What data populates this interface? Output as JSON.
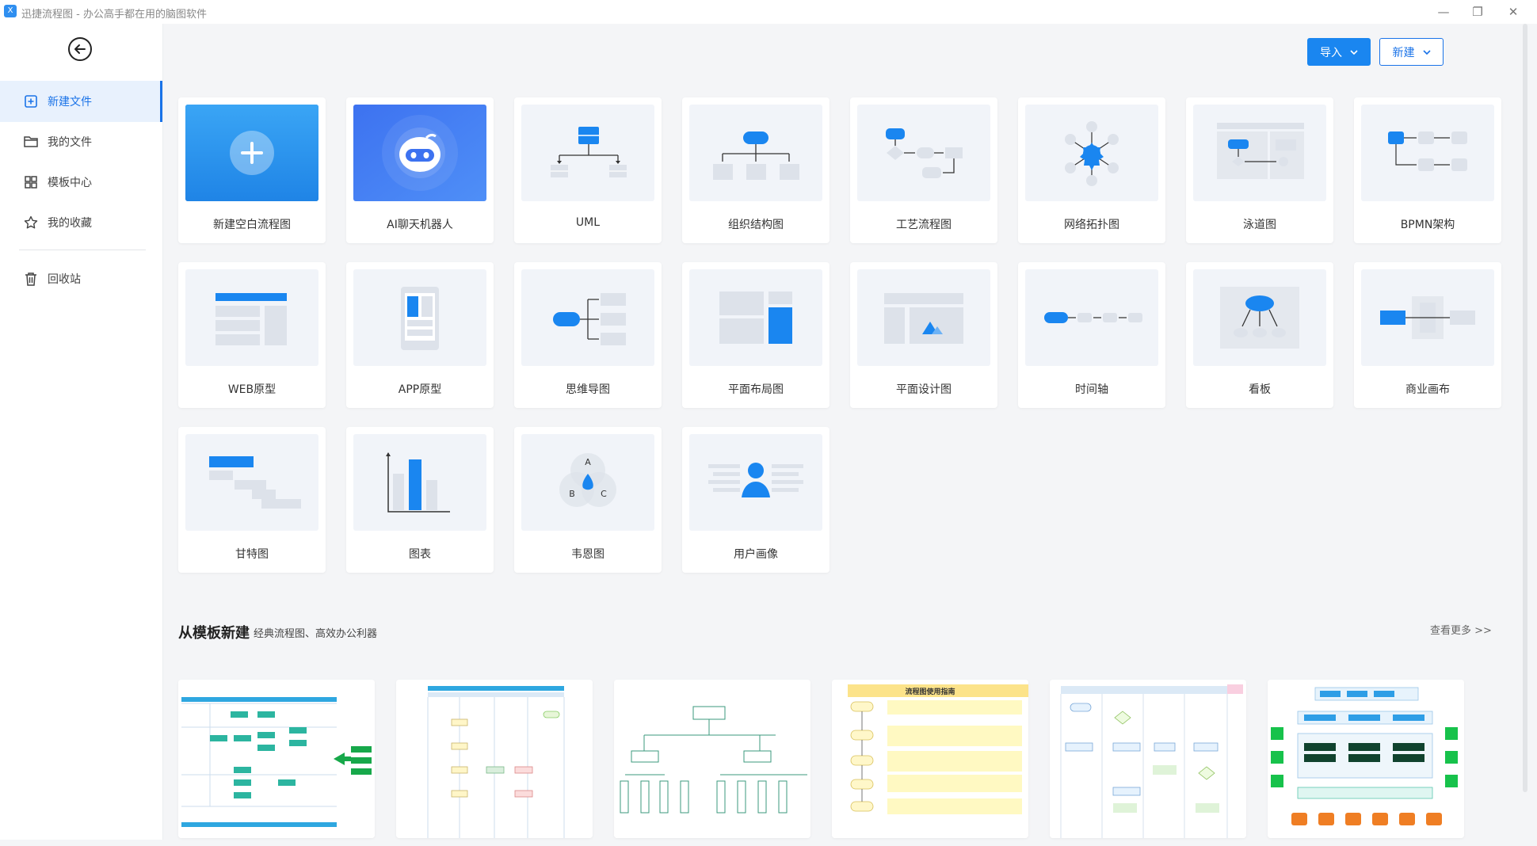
{
  "window": {
    "title": "迅捷流程图 - 办公高手都在用的脑图软件",
    "logo_text": "X",
    "controls": [
      "—",
      "❐",
      "✕"
    ]
  },
  "sidebar": {
    "items": [
      {
        "label": "新建文件",
        "icon": "add-file-icon",
        "active": true
      },
      {
        "label": "我的文件",
        "icon": "folder-icon",
        "active": false
      },
      {
        "label": "模板中心",
        "icon": "grid-icon",
        "active": false
      },
      {
        "label": "我的收藏",
        "icon": "star-icon",
        "active": false
      },
      {
        "label": "回收站",
        "icon": "trash-icon",
        "active": false
      }
    ]
  },
  "header": {
    "import_label": "导入",
    "new_label": "新建"
  },
  "cards": [
    {
      "label": "新建空白流程图"
    },
    {
      "label": "AI聊天机器人"
    },
    {
      "label": "UML"
    },
    {
      "label": "组织结构图"
    },
    {
      "label": "工艺流程图"
    },
    {
      "label": "网络拓扑图"
    },
    {
      "label": "泳道图"
    },
    {
      "label": "BPMN架构"
    },
    {
      "label": "WEB原型"
    },
    {
      "label": "APP原型"
    },
    {
      "label": "思维导图"
    },
    {
      "label": "平面布局图"
    },
    {
      "label": "平面设计图"
    },
    {
      "label": "时间轴"
    },
    {
      "label": "看板"
    },
    {
      "label": "商业画布"
    },
    {
      "label": "甘特图"
    },
    {
      "label": "图表"
    },
    {
      "label": "韦恩图"
    },
    {
      "label": "用户画像"
    }
  ],
  "venn_letters": [
    "A",
    "B",
    "C"
  ],
  "templates": {
    "title": "从模板新建",
    "subtitle": "经典流程图、高效办公利器",
    "see_more": "查看更多 >>",
    "thumb_title": "流程图使用指南"
  },
  "colors": {
    "accent": "#1a73e8",
    "button_blue": "#1a86f0",
    "icon_blue": "#1a86f0",
    "thumb_bg": "#f1f4f9",
    "placeholder_gray": "#dde2ea"
  }
}
